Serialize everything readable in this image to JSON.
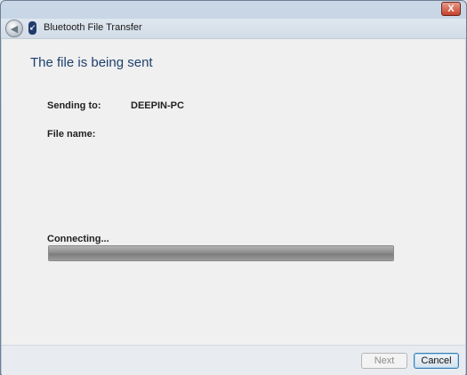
{
  "window": {
    "title": "Bluetooth File Transfer",
    "close_glyph": "X"
  },
  "icons": {
    "back": "back-arrow-icon",
    "bluetooth": "bluetooth-icon",
    "close": "close-icon"
  },
  "main": {
    "heading": "The file is being sent",
    "sending_to_label": "Sending to:",
    "sending_to_value": "DEEPIN-PC",
    "file_name_label": "File name:",
    "file_name_value": "",
    "status": "Connecting...",
    "progress": 1.0
  },
  "footer": {
    "next_label": "Next",
    "cancel_label": "Cancel"
  },
  "colors": {
    "heading": "#1e3f6e",
    "titlebar": "#c9d7e6",
    "cancel_border": "#3c7fb1"
  }
}
